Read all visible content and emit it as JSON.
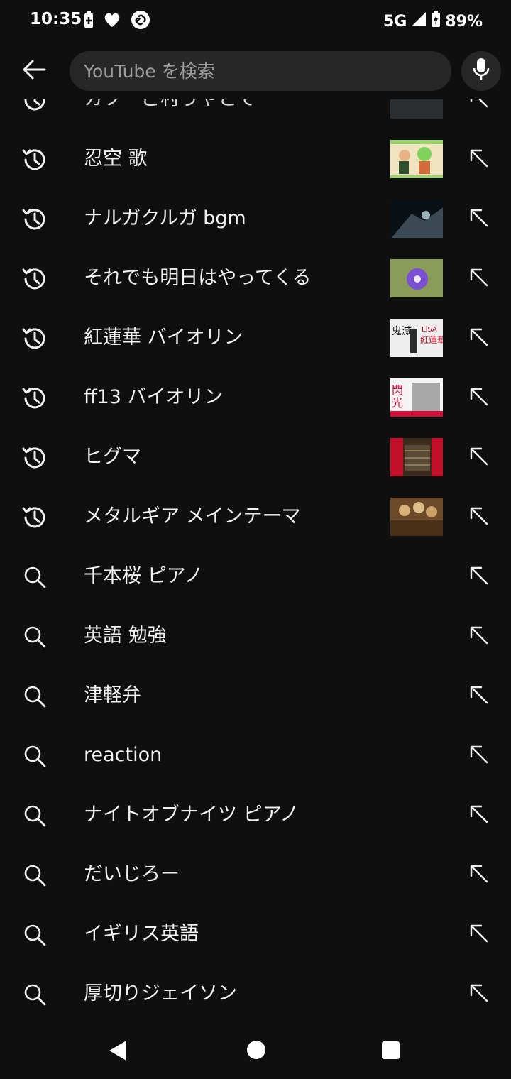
{
  "status_bar": {
    "time": "10:35",
    "network": "5G",
    "battery": "89%"
  },
  "search": {
    "placeholder": "YouTube を検索",
    "value": ""
  },
  "list": [
    {
      "text": "カフーご村うやとて",
      "type": "history",
      "has_thumb": true,
      "thumb": "dark-street"
    },
    {
      "text": "忍空 歌",
      "type": "history",
      "has_thumb": true,
      "thumb": "anime"
    },
    {
      "text": "ナルガクルガ bgm",
      "type": "history",
      "has_thumb": true,
      "thumb": "monster"
    },
    {
      "text": "それでも明日はやってくる",
      "type": "history",
      "has_thumb": true,
      "thumb": "flower"
    },
    {
      "text": "紅蓮華 バイオリン",
      "type": "history",
      "has_thumb": true,
      "thumb": "violin-lisa"
    },
    {
      "text": "ff13 バイオリン",
      "type": "history",
      "has_thumb": true,
      "thumb": "violin-ff"
    },
    {
      "text": "ヒグマ",
      "type": "history",
      "has_thumb": true,
      "thumb": "bear"
    },
    {
      "text": "メタルギア メインテーマ",
      "type": "history",
      "has_thumb": true,
      "thumb": "metalgear"
    },
    {
      "text": "千本桜 ピアノ",
      "type": "search",
      "has_thumb": false
    },
    {
      "text": "英語 勉強",
      "type": "search",
      "has_thumb": false
    },
    {
      "text": "津軽弁",
      "type": "search",
      "has_thumb": false
    },
    {
      "text": "reaction",
      "type": "search",
      "has_thumb": false
    },
    {
      "text": "ナイトオブナイツ ピアノ",
      "type": "search",
      "has_thumb": false
    },
    {
      "text": "だいじろー",
      "type": "search",
      "has_thumb": false
    },
    {
      "text": "イギリス英語",
      "type": "search",
      "has_thumb": false
    },
    {
      "text": "厚切りジェイソン",
      "type": "search",
      "has_thumb": false
    }
  ],
  "icons": {
    "history": "history-icon",
    "search": "search-icon",
    "fill": "arrow-up-left-icon"
  },
  "colors": {
    "background": "#0f0f0f",
    "search_box": "#272727",
    "text": "#f1f1f1"
  }
}
